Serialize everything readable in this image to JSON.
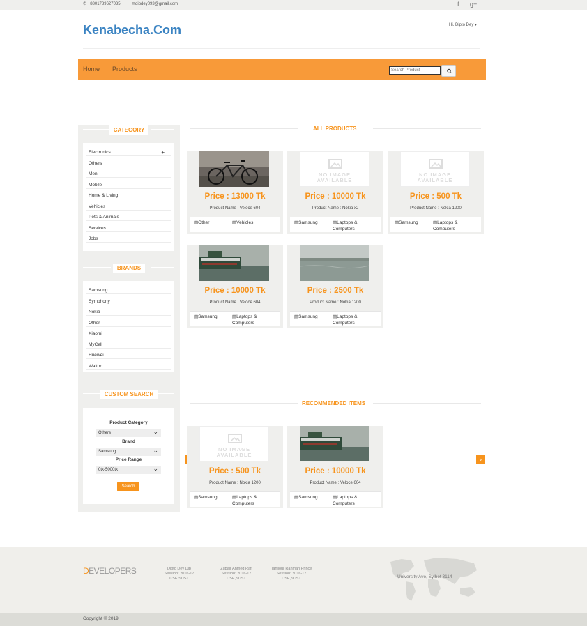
{
  "topbar": {
    "phone": "+8801789627035",
    "email": "dipdey093@gmail.com",
    "facebook": "f",
    "googleplus": "g+"
  },
  "header": {
    "brand": "Kenabecha.Com",
    "greeting": "Hi, Dipto Dey"
  },
  "nav": {
    "home": "Home",
    "products": "Products",
    "search_placeholder": "Search Product"
  },
  "sidebar": {
    "category_title": "CATEGORY",
    "categories": [
      "Electronics",
      "Others",
      "Men",
      "Mobile",
      "Home & Living",
      "Vehicles",
      "Pets & Animals",
      "Services",
      "Jobs"
    ],
    "expand_symbol": "+",
    "brands_title": "BRANDS",
    "brands": [
      "Samsung",
      "Symphony",
      "Nokia",
      "Other",
      "Xiaomi",
      "MyCell",
      "Huewei",
      "Walton"
    ],
    "custom_title": "CUSTOM SEARCH",
    "product_category_label": "Product Category",
    "product_category_value": "Others",
    "brand_label": "Brand",
    "brand_value": "Samsung",
    "price_label": "Price Range",
    "price_value": "0tk-5000tk",
    "search_btn": "Search"
  },
  "all_products": {
    "title": "ALL PRODUCTS",
    "items": [
      {
        "price": "Price : 13000 Tk",
        "name": "Product Name : Veloce 604",
        "tag1": "Other",
        "tag2": "Vehicles",
        "image": "bicycle"
      },
      {
        "price": "Price : 10000 Tk",
        "name": "Product Name : Nokia x2",
        "tag1": "Samsung",
        "tag2": "Laptops & Computers",
        "image": "no-image"
      },
      {
        "price": "Price : 500 Tk",
        "name": "Product Name : Nokia 1200",
        "tag1": "Samsung",
        "tag2": "Laptops & Computers",
        "image": "no-image"
      },
      {
        "price": "Price : 10000 Tk",
        "name": "Product Name : Veloce 604",
        "tag1": "Samsung",
        "tag2": "Laptops & Computers",
        "image": "boat"
      },
      {
        "price": "Price : 2500 Tk",
        "name": "Product Name : Nokia 1200",
        "tag1": "Samsung",
        "tag2": "Laptops & Computers",
        "image": "river"
      }
    ]
  },
  "recommended": {
    "title": "RECOMMENDED ITEMS",
    "items": [
      {
        "price": "Price : 500 Tk",
        "name": "Product Name : Nokia 1200",
        "tag1": "Samsung",
        "tag2": "Laptops & Computers",
        "image": "no-image"
      },
      {
        "price": "Price : 10000 Tk",
        "name": "Product Name : Veloce 604",
        "tag1": "Samsung",
        "tag2": "Laptops & Computers",
        "image": "boat"
      }
    ],
    "prev": "‹",
    "next": "›"
  },
  "no_image_text": {
    "line1": "NO IMAGE",
    "line2": "AVAILABLE"
  },
  "footer": {
    "developers_first": "D",
    "developers_rest": "EVELOPERS",
    "devs": [
      {
        "name": "Dipto Dey Dip",
        "session": "Session: 2016-17",
        "dept": "CSE,SUST"
      },
      {
        "name": "Zubair Ahmed Rafi",
        "session": "Session: 2016-17",
        "dept": "CSE,SUST"
      },
      {
        "name": "Tanjiour Rahman Prince",
        "session": "Session: 2016-17",
        "dept": "CSE,SUST"
      }
    ],
    "address": "University Ave, Sylhet 3114",
    "copyright": "Copyright © 2019"
  },
  "colors": {
    "accent": "#f7941d",
    "nav": "#f89a39",
    "brand": "#3a83c2"
  }
}
